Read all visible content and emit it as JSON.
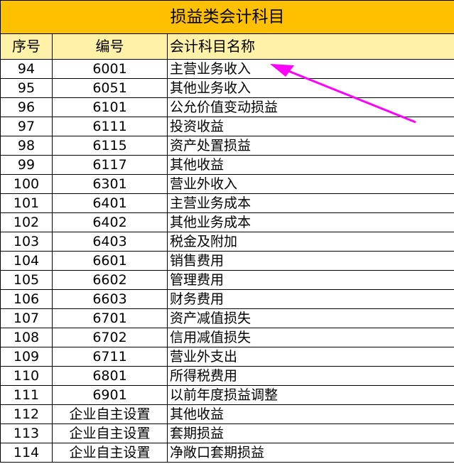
{
  "title": "损益类会计科目",
  "headers": {
    "index": "序号",
    "code": "编号",
    "name": "会计科目名称"
  },
  "rows": [
    {
      "index": "94",
      "code": "6001",
      "name": "主营业务收入"
    },
    {
      "index": "95",
      "code": "6051",
      "name": "其他业务收入"
    },
    {
      "index": "96",
      "code": "6101",
      "name": "公允价值变动损益"
    },
    {
      "index": "97",
      "code": "6111",
      "name": "投资收益"
    },
    {
      "index": "98",
      "code": "6115",
      "name": "资产处置损益"
    },
    {
      "index": "99",
      "code": "6117",
      "name": "其他收益"
    },
    {
      "index": "100",
      "code": "6301",
      "name": "营业外收入"
    },
    {
      "index": "101",
      "code": "6401",
      "name": "主营业务成本"
    },
    {
      "index": "102",
      "code": "6402",
      "name": "其他业务成本"
    },
    {
      "index": "103",
      "code": "6403",
      "name": "税金及附加"
    },
    {
      "index": "104",
      "code": "6601",
      "name": "销售费用"
    },
    {
      "index": "105",
      "code": "6602",
      "name": "管理费用"
    },
    {
      "index": "106",
      "code": "6603",
      "name": "财务费用"
    },
    {
      "index": "107",
      "code": "6701",
      "name": "资产减值损失"
    },
    {
      "index": "108",
      "code": "6702",
      "name": "信用减值损失"
    },
    {
      "index": "109",
      "code": "6711",
      "name": "营业外支出"
    },
    {
      "index": "110",
      "code": "6801",
      "name": "所得税费用"
    },
    {
      "index": "111",
      "code": "6901",
      "name": "以前年度损益调整"
    },
    {
      "index": "112",
      "code": "企业自主设置",
      "name": "其他收益"
    },
    {
      "index": "113",
      "code": "企业自主设置",
      "name": "套期损益"
    },
    {
      "index": "114",
      "code": "企业自主设置",
      "name": "净敞口套期损益"
    }
  ],
  "colors": {
    "title_bg": "#FFC000",
    "header_bg": "#FFF2A8",
    "arrow": "#FF00FF"
  }
}
